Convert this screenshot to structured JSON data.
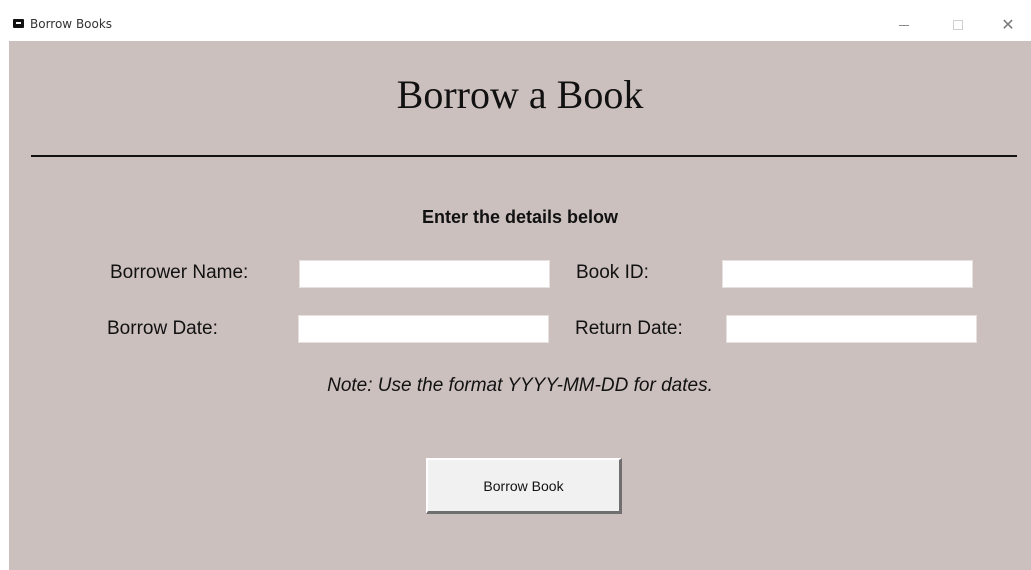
{
  "window": {
    "title": "Borrow Books",
    "controls": {
      "minimize": "minimize-icon",
      "maximize": "maximize-icon",
      "close": "close-icon"
    }
  },
  "form": {
    "heading": "Borrow a Book",
    "subheading": "Enter the details below",
    "fields": {
      "borrower_name": {
        "label": "Borrower Name:",
        "value": ""
      },
      "book_id": {
        "label": "Book ID:",
        "value": ""
      },
      "borrow_date": {
        "label": "Borrow Date:",
        "value": ""
      },
      "return_date": {
        "label": "Return Date:",
        "value": ""
      }
    },
    "note": "Note: Use the format YYYY-MM-DD for dates.",
    "submit_label": "Borrow Book"
  },
  "colors": {
    "background": "#cbc0bd",
    "input_background": "#ffffff",
    "text": "#111111"
  }
}
